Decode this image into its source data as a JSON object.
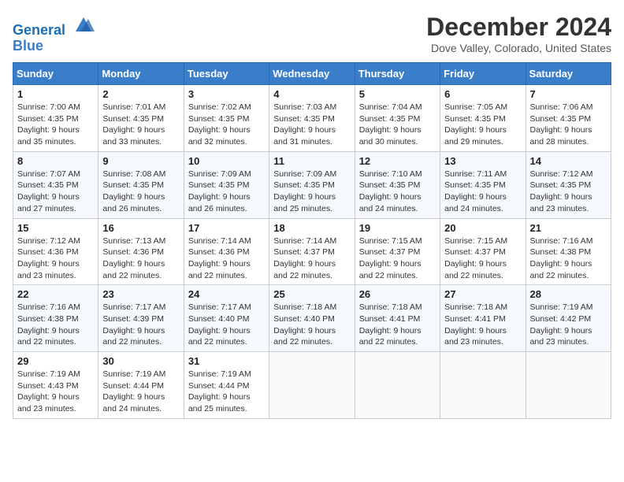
{
  "header": {
    "logo_line1": "General",
    "logo_line2": "Blue",
    "title": "December 2024",
    "location": "Dove Valley, Colorado, United States"
  },
  "calendar": {
    "headers": [
      "Sunday",
      "Monday",
      "Tuesday",
      "Wednesday",
      "Thursday",
      "Friday",
      "Saturday"
    ],
    "weeks": [
      [
        {
          "day": "",
          "empty": true
        },
        {
          "day": "",
          "empty": true
        },
        {
          "day": "",
          "empty": true
        },
        {
          "day": "",
          "empty": true
        },
        {
          "day": "",
          "empty": true
        },
        {
          "day": "",
          "empty": true
        },
        {
          "day": "",
          "empty": true
        }
      ],
      [
        {
          "day": "1",
          "sunrise": "7:00 AM",
          "sunset": "4:35 PM",
          "daylight": "9 hours and 35 minutes."
        },
        {
          "day": "2",
          "sunrise": "7:01 AM",
          "sunset": "4:35 PM",
          "daylight": "9 hours and 33 minutes."
        },
        {
          "day": "3",
          "sunrise": "7:02 AM",
          "sunset": "4:35 PM",
          "daylight": "9 hours and 32 minutes."
        },
        {
          "day": "4",
          "sunrise": "7:03 AM",
          "sunset": "4:35 PM",
          "daylight": "9 hours and 31 minutes."
        },
        {
          "day": "5",
          "sunrise": "7:04 AM",
          "sunset": "4:35 PM",
          "daylight": "9 hours and 30 minutes."
        },
        {
          "day": "6",
          "sunrise": "7:05 AM",
          "sunset": "4:35 PM",
          "daylight": "9 hours and 29 minutes."
        },
        {
          "day": "7",
          "sunrise": "7:06 AM",
          "sunset": "4:35 PM",
          "daylight": "9 hours and 28 minutes."
        }
      ],
      [
        {
          "day": "8",
          "sunrise": "7:07 AM",
          "sunset": "4:35 PM",
          "daylight": "9 hours and 27 minutes."
        },
        {
          "day": "9",
          "sunrise": "7:08 AM",
          "sunset": "4:35 PM",
          "daylight": "9 hours and 26 minutes."
        },
        {
          "day": "10",
          "sunrise": "7:09 AM",
          "sunset": "4:35 PM",
          "daylight": "9 hours and 26 minutes."
        },
        {
          "day": "11",
          "sunrise": "7:09 AM",
          "sunset": "4:35 PM",
          "daylight": "9 hours and 25 minutes."
        },
        {
          "day": "12",
          "sunrise": "7:10 AM",
          "sunset": "4:35 PM",
          "daylight": "9 hours and 24 minutes."
        },
        {
          "day": "13",
          "sunrise": "7:11 AM",
          "sunset": "4:35 PM",
          "daylight": "9 hours and 24 minutes."
        },
        {
          "day": "14",
          "sunrise": "7:12 AM",
          "sunset": "4:35 PM",
          "daylight": "9 hours and 23 minutes."
        }
      ],
      [
        {
          "day": "15",
          "sunrise": "7:12 AM",
          "sunset": "4:36 PM",
          "daylight": "9 hours and 23 minutes."
        },
        {
          "day": "16",
          "sunrise": "7:13 AM",
          "sunset": "4:36 PM",
          "daylight": "9 hours and 22 minutes."
        },
        {
          "day": "17",
          "sunrise": "7:14 AM",
          "sunset": "4:36 PM",
          "daylight": "9 hours and 22 minutes."
        },
        {
          "day": "18",
          "sunrise": "7:14 AM",
          "sunset": "4:37 PM",
          "daylight": "9 hours and 22 minutes."
        },
        {
          "day": "19",
          "sunrise": "7:15 AM",
          "sunset": "4:37 PM",
          "daylight": "9 hours and 22 minutes."
        },
        {
          "day": "20",
          "sunrise": "7:15 AM",
          "sunset": "4:37 PM",
          "daylight": "9 hours and 22 minutes."
        },
        {
          "day": "21",
          "sunrise": "7:16 AM",
          "sunset": "4:38 PM",
          "daylight": "9 hours and 22 minutes."
        }
      ],
      [
        {
          "day": "22",
          "sunrise": "7:16 AM",
          "sunset": "4:38 PM",
          "daylight": "9 hours and 22 minutes."
        },
        {
          "day": "23",
          "sunrise": "7:17 AM",
          "sunset": "4:39 PM",
          "daylight": "9 hours and 22 minutes."
        },
        {
          "day": "24",
          "sunrise": "7:17 AM",
          "sunset": "4:40 PM",
          "daylight": "9 hours and 22 minutes."
        },
        {
          "day": "25",
          "sunrise": "7:18 AM",
          "sunset": "4:40 PM",
          "daylight": "9 hours and 22 minutes."
        },
        {
          "day": "26",
          "sunrise": "7:18 AM",
          "sunset": "4:41 PM",
          "daylight": "9 hours and 22 minutes."
        },
        {
          "day": "27",
          "sunrise": "7:18 AM",
          "sunset": "4:41 PM",
          "daylight": "9 hours and 23 minutes."
        },
        {
          "day": "28",
          "sunrise": "7:19 AM",
          "sunset": "4:42 PM",
          "daylight": "9 hours and 23 minutes."
        }
      ],
      [
        {
          "day": "29",
          "sunrise": "7:19 AM",
          "sunset": "4:43 PM",
          "daylight": "9 hours and 23 minutes."
        },
        {
          "day": "30",
          "sunrise": "7:19 AM",
          "sunset": "4:44 PM",
          "daylight": "9 hours and 24 minutes."
        },
        {
          "day": "31",
          "sunrise": "7:19 AM",
          "sunset": "4:44 PM",
          "daylight": "9 hours and 25 minutes."
        },
        {
          "day": "",
          "empty": true
        },
        {
          "day": "",
          "empty": true
        },
        {
          "day": "",
          "empty": true
        },
        {
          "day": "",
          "empty": true
        }
      ]
    ]
  }
}
